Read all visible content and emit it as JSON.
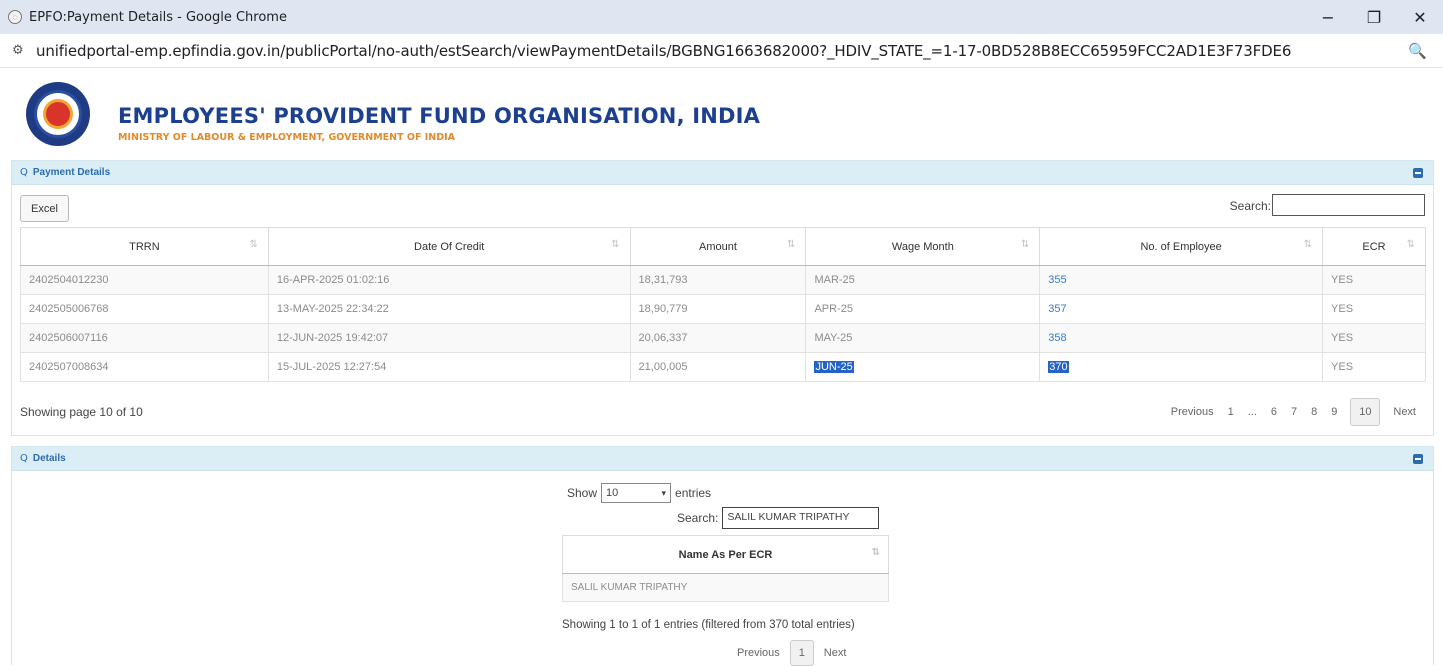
{
  "window": {
    "title": "EPFO:Payment Details - Google Chrome",
    "controls": {
      "minimize": "−",
      "restore": "❐",
      "close": "✕"
    }
  },
  "address_bar": {
    "url": "unifiedportal-emp.epfindia.gov.in/publicPortal/no-auth/estSearch/viewPaymentDetails/BGBNG1663682000?_HDIV_STATE_=1-17-0BD528B8ECC65959FCC2AD1E3F73FDE6"
  },
  "header": {
    "org_name": "EMPLOYEES' PROVIDENT FUND ORGANISATION, INDIA",
    "ministry": "MINISTRY OF LABOUR & EMPLOYMENT, GOVERNMENT OF INDIA"
  },
  "payment_panel": {
    "title": "Payment Details",
    "excel_label": "Excel",
    "search_label": "Search:",
    "search_value": "",
    "columns": [
      "TRRN",
      "Date Of Credit",
      "Amount",
      "Wage Month",
      "No. of Employee",
      "ECR"
    ],
    "rows": [
      {
        "trrn": "2402504012230",
        "date": "16-APR-2025 01:02:16",
        "amount": "18,31,793",
        "wage_month": "MAR-25",
        "employees": "355",
        "ecr": "YES"
      },
      {
        "trrn": "2402505006768",
        "date": "13-MAY-2025 22:34:22",
        "amount": "18,90,779",
        "wage_month": "APR-25",
        "employees": "357",
        "ecr": "YES"
      },
      {
        "trrn": "2402506007116",
        "date": "12-JUN-2025 19:42:07",
        "amount": "20,06,337",
        "wage_month": "MAY-25",
        "employees": "358",
        "ecr": "YES"
      },
      {
        "trrn": "2402507008634",
        "date": "15-JUL-2025 12:27:54",
        "amount": "21,00,005",
        "wage_month": "JUN-25",
        "employees": "370",
        "ecr": "YES"
      }
    ],
    "showing": "Showing page 10 of 10",
    "pager": {
      "previous": "Previous",
      "pages": [
        "1",
        "...",
        "6",
        "7",
        "8",
        "9"
      ],
      "current": "10",
      "next": "Next"
    }
  },
  "details_panel": {
    "title": "Details",
    "show_label": "Show",
    "show_value": "10",
    "entries_label": "entries",
    "search_label": "Search:",
    "search_value": "SALIL KUMAR TRIPATHY",
    "column": "Name As Per ECR",
    "rows": [
      "SALIL KUMAR TRIPATHY"
    ],
    "info": "Showing 1 to 1 of 1 entries (filtered from 370 total entries)",
    "pager": {
      "previous": "Previous",
      "current": "1",
      "next": "Next"
    }
  }
}
